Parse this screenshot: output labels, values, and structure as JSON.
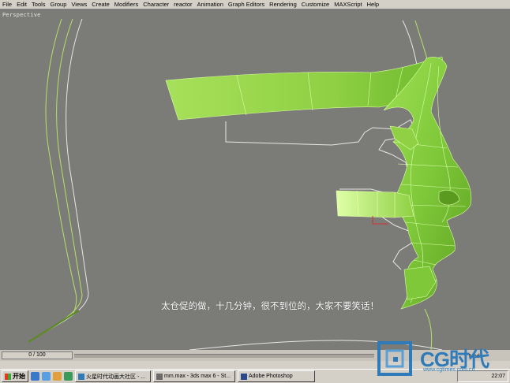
{
  "menu": [
    "File",
    "Edit",
    "Tools",
    "Group",
    "Views",
    "Create",
    "Modifiers",
    "Character",
    "reactor",
    "Animation",
    "Graph Editors",
    "Rendering",
    "Customize",
    "MAXScript",
    "Help"
  ],
  "viewport": {
    "label": "Perspective"
  },
  "caption": "太仓促的做，十几分钟，很不到位的，大家不要笑话！",
  "timeline": {
    "frame": "0 / 100",
    "mode": "Mode"
  },
  "taskbar": {
    "start": "开始",
    "tasks": [
      "火星时代动画大社区 - ...",
      "mm.max - 3ds max 6 - St...",
      "Adobe Photoshop"
    ],
    "clock": "22:07"
  },
  "watermark": {
    "brand": "CG时代",
    "url": "www.cgtimes.com.cn"
  },
  "colors": {
    "mesh_light": "#b5ec6a",
    "mesh_dark": "#6fae2a",
    "wire": "#e8ffb0",
    "background": "#7b7b77"
  }
}
